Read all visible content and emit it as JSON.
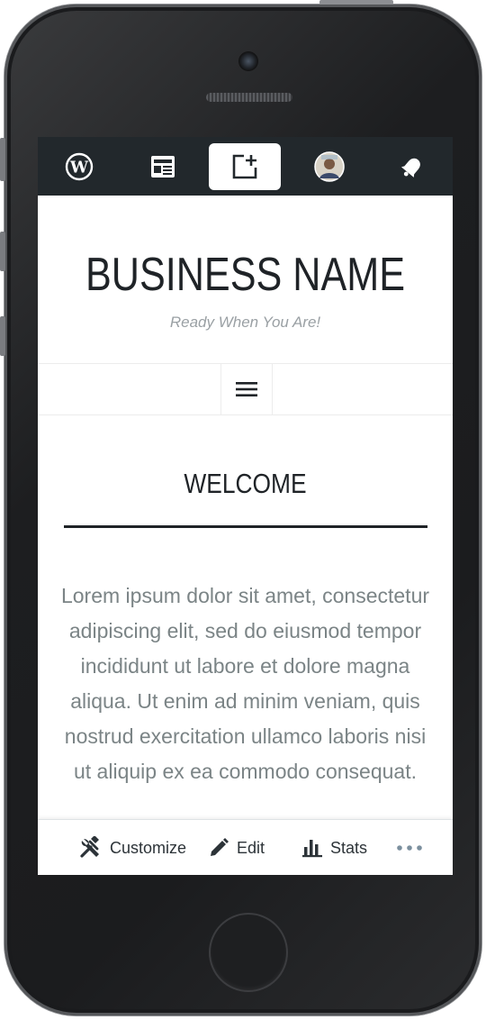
{
  "device": {
    "type": "iPhone",
    "frame_color": "#1c1d1f"
  },
  "topbar": {
    "background": "#22282c",
    "items": [
      {
        "icon": "wordpress-icon",
        "active": false
      },
      {
        "icon": "reader-icon",
        "active": false
      },
      {
        "icon": "write-post-icon",
        "active": true
      },
      {
        "icon": "avatar",
        "active": false
      },
      {
        "icon": "notifications-bell-icon",
        "active": false
      }
    ]
  },
  "site": {
    "title": "BUSINESS NAME",
    "tagline": "Ready When You Are!"
  },
  "nav": {
    "menu_icon": "hamburger-menu-icon"
  },
  "content": {
    "heading": "WELCOME",
    "body": "Lorem ipsum dolor sit amet, consectetur adipiscing elit, sed do eiusmod tempor incididunt ut labore et dolore magna aliqua. Ut enim ad minim veniam, quis nostrud exercitation ullamco laboris nisi ut aliquip ex ea commodo consequat."
  },
  "actionbar": {
    "customize_label": "Customize",
    "edit_label": "Edit",
    "stats_label": "Stats",
    "more_icon": "more-horizontal-icon"
  },
  "colors": {
    "text_dark": "#1f2327",
    "text_muted": "#7b8486",
    "tagline": "#9aa0a4"
  }
}
